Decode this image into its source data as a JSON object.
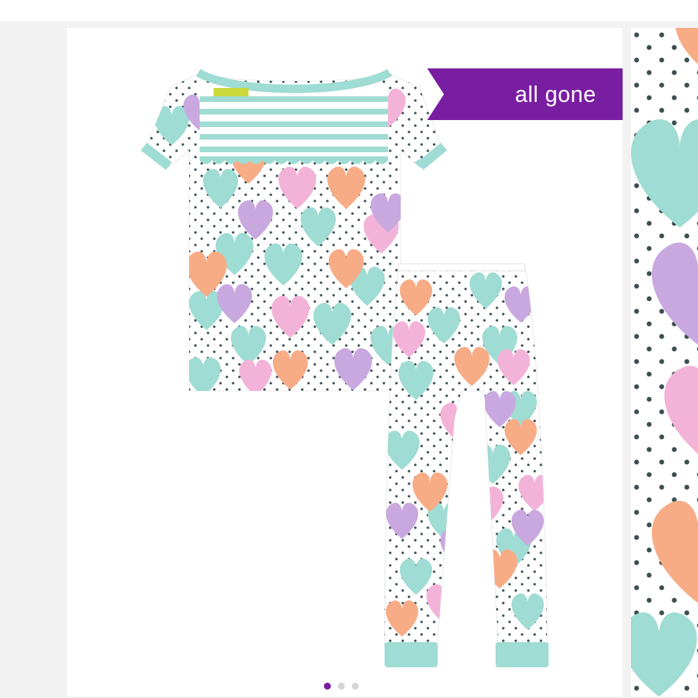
{
  "badge": {
    "text": "all gone",
    "color": "#7a1ea1"
  },
  "product_image": {
    "description_icon": "heart-print-pajama-set",
    "palette": {
      "mint": "#9fdcd3",
      "pink": "#f3b3d8",
      "peach": "#f7ac86",
      "lavender": "#c9a8e0",
      "dot": "#3d4f52"
    }
  },
  "carousel": {
    "total_slides": 3,
    "active_index": 0
  }
}
